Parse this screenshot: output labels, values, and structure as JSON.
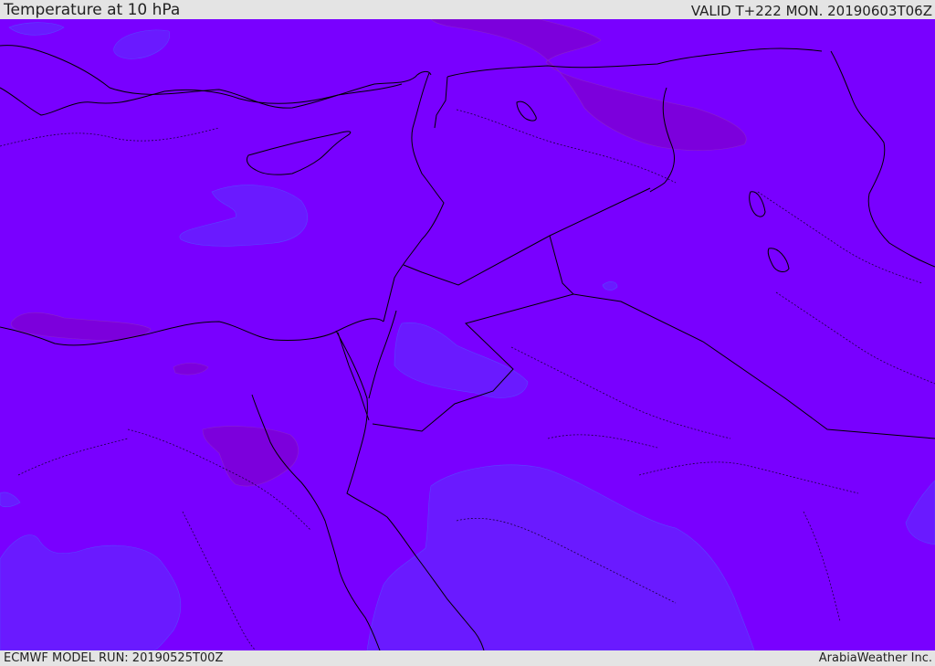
{
  "header": {
    "title": "Temperature at 10 hPa",
    "valid": "VALID T+222 MON. 20190603T06Z"
  },
  "footer": {
    "model_run": "ECMWF MODEL RUN: 20190525T00Z",
    "credit": "ArabiaWeather Inc."
  },
  "colors": {
    "base_fill": "#7900ff",
    "cooler_fill": "#6a1aff",
    "warmer_fill": "#7c00dc",
    "coastline": "#000000"
  }
}
